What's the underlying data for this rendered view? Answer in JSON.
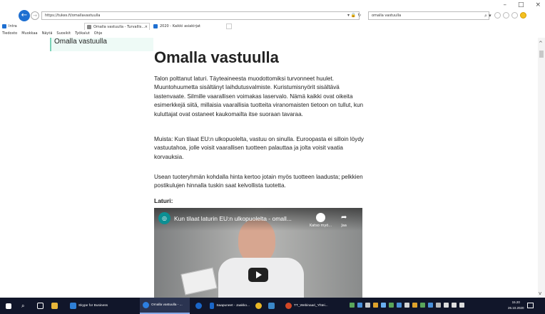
{
  "window_controls": {
    "minimize": "–",
    "maximize": "□",
    "close": "×"
  },
  "address_bar": {
    "url": "https://tukes.fi/omallavastuulla",
    "lock_refresh": "▾ 🔒 ↻",
    "search_value": "omalla vastuulla",
    "search_glyph": "⌕ ▾"
  },
  "tabs": [
    {
      "label": "Intra",
      "close": ""
    },
    {
      "label": "Omalla vastuulla - Turvallis...",
      "close": "×"
    },
    {
      "label": "2020 - Kaikki asiakirjat",
      "close": ""
    }
  ],
  "menu": [
    "Tiedosto",
    "Muokkaa",
    "Näytä",
    "Suosikit",
    "Työkalut",
    "Ohje"
  ],
  "sidebar": {
    "title": "Omalla vastuulla"
  },
  "article": {
    "title": "Omalla vastuulla",
    "p1": "Talon polttanut laturi. Täyteaineesta muodottomiksi turvonneet huulet. Muuntohuumetta sisältänyt laihdutusvalmiste. Kuristumisnyörit sisältävä lastenvaate. Silmille vaarallisen voimakas laservalo. Nämä kaikki ovat oikeita esimerkkejä siitä, millaisia vaarallisia tuotteita viranomaisten tietoon on tullut, kun kuluttajat ovat ostaneet kaukomailta itse suoraan tavaraa.",
    "p2": "Muista: Kun tilaat EU:n ulkopuolelta, vastuu on sinulla. Euroopasta ei silloin löydy vastuutahoa, jolle voisit vaarallisen tuotteen palauttaa ja jolta voisit vaatia korvauksia.",
    "p3": "Usean tuoteryhmän kohdalla hinta kertoo jotain myös tuotteen laadusta; pelkkien postikulujen hinnalla tuskin saat kelvollista tuotetta.",
    "laturi_label": "Laturi:"
  },
  "video": {
    "title": "Kun tilaat laturin EU:n ulkopuolelta - omall...",
    "watch_later": "Katso myö...",
    "share": "Jaa"
  },
  "taskbar": {
    "items": [
      {
        "label": "Skype for Business",
        "color": "#2f7fd6"
      },
      {
        "label": "Omalla vastuulla - ...",
        "color": "#2d7fe0"
      },
      {
        "label": "Saapuneet - Jaakko...",
        "color": "#1a66c8"
      },
      {
        "label": "TT_Webinaari_Yhtei...",
        "color": "#d24726"
      }
    ],
    "time": "15.20",
    "date": "26.10.2020"
  },
  "colors": {
    "accent_blue": "#1e6fd1",
    "sidebar_border": "#7bd3b8",
    "taskbar_bg": "#11162a"
  }
}
